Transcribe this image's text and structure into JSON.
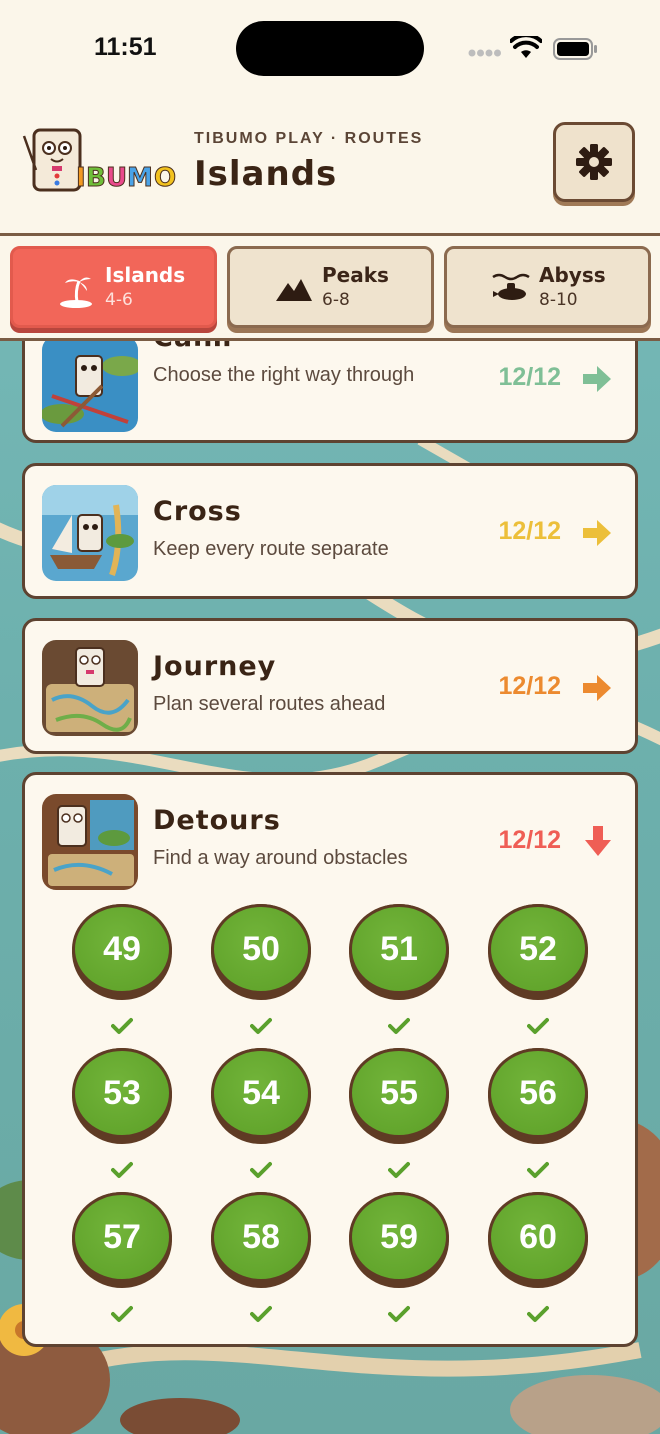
{
  "status": {
    "time": "11:51"
  },
  "header": {
    "logo_text": "TIBUMO",
    "breadcrumb": "TIBUMO PLAY · ROUTES",
    "title": "Islands"
  },
  "tabs": [
    {
      "name": "Islands",
      "range": "4-6",
      "icon": "palm-island-icon",
      "active": true
    },
    {
      "name": "Peaks",
      "range": "6-8",
      "icon": "mountain-icon",
      "active": false
    },
    {
      "name": "Abyss",
      "range": "8-10",
      "icon": "submarine-icon",
      "active": false
    }
  ],
  "packs": [
    {
      "title": "Calm",
      "subtitle": "Choose the right way through",
      "progress": "12/12",
      "color": "#7fbf96",
      "arrow": "right"
    },
    {
      "title": "Cross",
      "subtitle": "Keep every route separate",
      "progress": "12/12",
      "color": "#ecbf3a",
      "arrow": "right"
    },
    {
      "title": "Journey",
      "subtitle": "Plan several routes ahead",
      "progress": "12/12",
      "color": "#ec8a2f",
      "arrow": "right"
    },
    {
      "title": "Detours",
      "subtitle": "Find a way around obstacles",
      "progress": "12/12",
      "color": "#ef5e55",
      "arrow": "down"
    }
  ],
  "levels": [
    {
      "num": "49",
      "done": true
    },
    {
      "num": "50",
      "done": true
    },
    {
      "num": "51",
      "done": true
    },
    {
      "num": "52",
      "done": true
    },
    {
      "num": "53",
      "done": true
    },
    {
      "num": "54",
      "done": true
    },
    {
      "num": "55",
      "done": true
    },
    {
      "num": "56",
      "done": true
    },
    {
      "num": "57",
      "done": true
    },
    {
      "num": "58",
      "done": true
    },
    {
      "num": "59",
      "done": true
    },
    {
      "num": "60",
      "done": true
    }
  ]
}
